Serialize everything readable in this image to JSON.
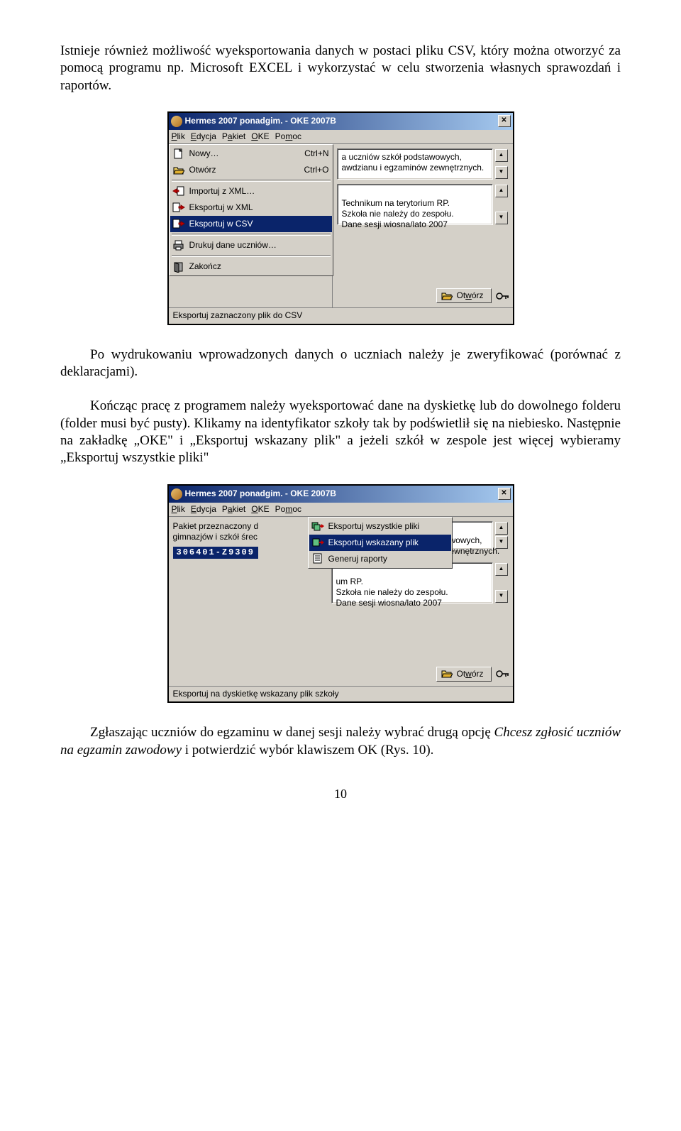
{
  "para1": "Istnieje również możliwość wyeksportowania danych w postaci pliku CSV, który można otworzyć za pomocą programu np. Microsoft EXCEL i wykorzystać w celu stworzenia własnych sprawozdań i raportów.",
  "para2": "Po wydrukowaniu wprowadzonych danych o uczniach należy je zweryfikować (porównać z deklaracjami).",
  "para3": "Kończąc pracę z programem należy wyeksportować dane na dyskietkę lub do dowolnego folderu (folder musi być pusty). Klikamy na identyfikator szkoły tak by podświetlił się na niebiesko. Następnie na zakładkę „OKE\" i „Eksportuj wskazany plik\" a jeżeli szkół w zespole jest więcej wybieramy „Eksportuj wszystkie pliki\"",
  "para4_a": "Zgłaszając uczniów do egzaminu w danej sesji należy wybrać drugą opcję ",
  "para4_i": "Chcesz zgłosić uczniów na egzamin zawodowy",
  "para4_b": " i potwierdzić wybór klawiszem OK (Rys. 10).",
  "pagenum": "10",
  "win1": {
    "title": "Hermes 2007 ponadgim. - OKE 2007B",
    "menu": [
      "Plik",
      "Edycja",
      "Pakiet",
      "OKE",
      "Pomoc"
    ],
    "items": [
      {
        "icon": "new",
        "label": "Nowy…",
        "hk": "Ctrl+N"
      },
      {
        "icon": "open",
        "label": "Otwórz",
        "hk": "Ctrl+O"
      },
      {
        "sep": true
      },
      {
        "icon": "impxml",
        "label": "Importuj z XML…",
        "hk": ""
      },
      {
        "icon": "expxml",
        "label": "Eksportuj w XML",
        "hk": ""
      },
      {
        "icon": "expcsv",
        "label": "Eksportuj w CSV",
        "hk": "",
        "selected": true
      },
      {
        "sep": true
      },
      {
        "icon": "print",
        "label": "Drukuj dane uczniów…",
        "hk": ""
      },
      {
        "sep": true
      },
      {
        "icon": "exit",
        "label": "Zakończ",
        "hk": ""
      }
    ],
    "info1": "a uczniów szkół podstawowych, awdzianu i egzaminów zewnętrznych.",
    "info2": "Technikum na terytorium RP.\nSzkoła nie należy do zespołu.\nDane sesji wiosna/lato 2007",
    "btn_open": "Otwórz",
    "status": "Eksportuj zaznaczony plik do CSV"
  },
  "win2": {
    "title": "Hermes 2007 ponadgim. - OKE 2007B",
    "menu": [
      "Plik",
      "Edycja",
      "Pakiet",
      "OKE",
      "Pomoc"
    ],
    "oke_items": [
      {
        "icon": "expall",
        "label": "Eksportuj wszystkie pliki"
      },
      {
        "icon": "expone",
        "label": "Eksportuj wskazany plik",
        "selected": true
      },
      {
        "icon": "report",
        "label": "Generuj raporty"
      }
    ],
    "left_info": "Pakiet przeznaczony d\ngimnazjów i szkół śrec",
    "chip": "306401-Z9309",
    "info2_a": "wowych,\newnętrznych.",
    "info2_b": "um RP.\nSzkoła nie należy do zespołu.\nDane sesji wiosna/lato 2007",
    "btn_open": "Otwórz",
    "status": "Eksportuj na dyskietkę wskazany plik szkoły"
  }
}
